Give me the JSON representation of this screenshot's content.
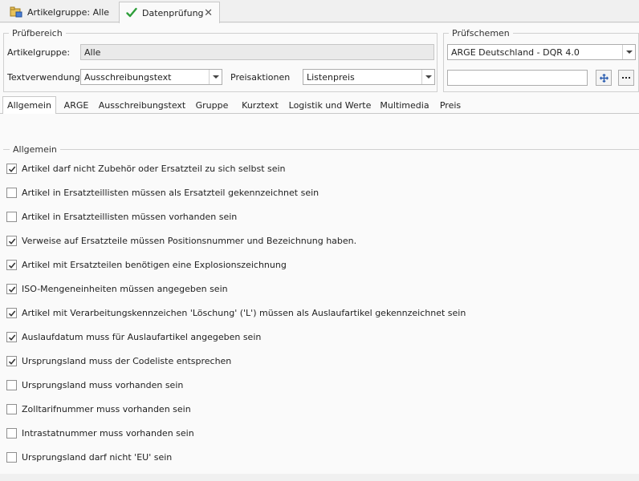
{
  "doc_tabs": [
    {
      "label": "Artikelgruppe: Alle"
    },
    {
      "label": "Datenprüfung"
    }
  ],
  "pruefbereich": {
    "legend": "Prüfbereich",
    "artikelgruppe_label": "Artikelgruppe:",
    "artikelgruppe_value": "Alle",
    "textverwendung_label": "Textverwendung:",
    "textverwendung_value": "Ausschreibungstext",
    "preisaktionen_label": "Preisaktionen",
    "preisaktionen_value": "Listenpreis"
  },
  "pruefschemen": {
    "legend": "Prüfschemen",
    "selected": "ARGE Deutschland - DQR 4.0",
    "search_value": ""
  },
  "tabs": [
    "Allgemein",
    "ARGE",
    "Ausschreibungstext",
    "Gruppe",
    "Kurztext",
    "Logistik und Werte",
    "Multimedia",
    "Preis"
  ],
  "allgemein": {
    "legend": "Allgemein",
    "items": [
      {
        "label": "Artikel darf nicht Zubehör oder Ersatzteil zu sich selbst sein",
        "checked": true
      },
      {
        "label": "Artikel in Ersatzteillisten müssen als Ersatzteil gekennzeichnet sein",
        "checked": false
      },
      {
        "label": "Artikel in Ersatzteillisten müssen vorhanden sein",
        "checked": false
      },
      {
        "label": "Verweise auf Ersatzteile müssen Positionsnummer und Bezeichnung haben.",
        "checked": true
      },
      {
        "label": "Artikel mit Ersatzteilen benötigen eine Explosionszeichnung",
        "checked": true
      },
      {
        "label": "ISO-Mengeneinheiten müssen angegeben sein",
        "checked": true
      },
      {
        "label": "Artikel mit Verarbeitungskennzeichen 'Löschung' ('L') müssen als Auslaufartikel gekennzeichnet sein",
        "checked": true
      },
      {
        "label": "Auslaufdatum muss für Auslaufartikel angegeben sein",
        "checked": true
      },
      {
        "label": "Ursprungsland muss der Codeliste entsprechen",
        "checked": true
      },
      {
        "label": "Ursprungsland muss vorhanden sein",
        "checked": false
      },
      {
        "label": "Zolltarifnummer muss vorhanden sein",
        "checked": false
      },
      {
        "label": "Intrastatnummer muss vorhanden sein",
        "checked": false
      },
      {
        "label": "Ursprungsland darf nicht 'EU' sein",
        "checked": false
      }
    ]
  }
}
